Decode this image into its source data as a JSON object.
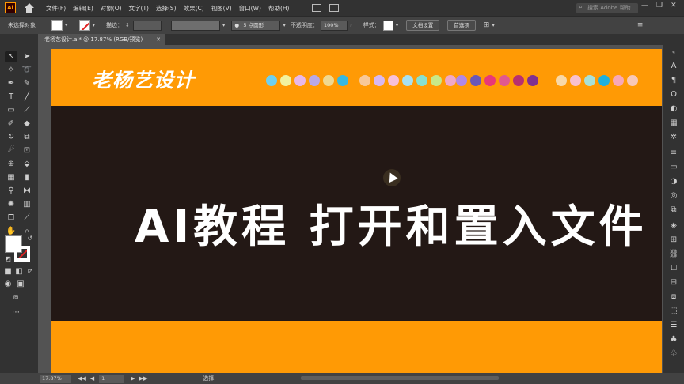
{
  "menubar": {
    "app_icon": "Ai",
    "items": [
      "文件(F)",
      "编辑(E)",
      "对象(O)",
      "文字(T)",
      "选择(S)",
      "效果(C)",
      "视图(V)",
      "窗口(W)",
      "帮助(H)"
    ],
    "search_placeholder": "搜索 Adobe 帮助",
    "controls": [
      "—",
      "❐",
      "✕"
    ]
  },
  "controlbar": {
    "selection_label": "未选择对象",
    "stroke_label": "描边：",
    "brush_label": "5 点圆形",
    "opacity_label": "不透明度：",
    "opacity_value": "100%",
    "style_label": "样式：",
    "doc_setup_button": "文档设置",
    "preferences_button": "首选项"
  },
  "tab": {
    "title": "老杨艺设计.ai* @ 17.87% (RGB/预览)",
    "close": "✕"
  },
  "canvas": {
    "logo": "老杨艺设计",
    "headline": "AI教程  打开和置入文件",
    "colors": {
      "orange": "#ff9a05",
      "dark": "#231815",
      "white": "#ffffff"
    },
    "dot_groups": [
      [
        "#6fd0f0",
        "#f2f2a0",
        "#e8b8e8",
        "#b8a8e8",
        "#f0d890",
        "#38b8e0"
      ],
      [
        "#f8c898",
        "#d8b8f0",
        "#f8c0d8",
        "#a8e0f0",
        "#88e0d0",
        "#c8e888",
        "#f0a8c8"
      ],
      [
        "#b088e8",
        "#6a58b8",
        "#e83878",
        "#e05890",
        "#b83070",
        "#803090"
      ],
      [
        "#f8d8a8",
        "#f8c0d0",
        "#a8e0d8",
        "#20b0e0",
        "#f8a8b8",
        "#f8c8b8"
      ]
    ]
  },
  "statusbar": {
    "zoom": "17.87%",
    "nav": [
      "◀◀",
      "◀",
      "▶",
      "▶▶"
    ],
    "page": "1",
    "tool_name": "选择"
  }
}
